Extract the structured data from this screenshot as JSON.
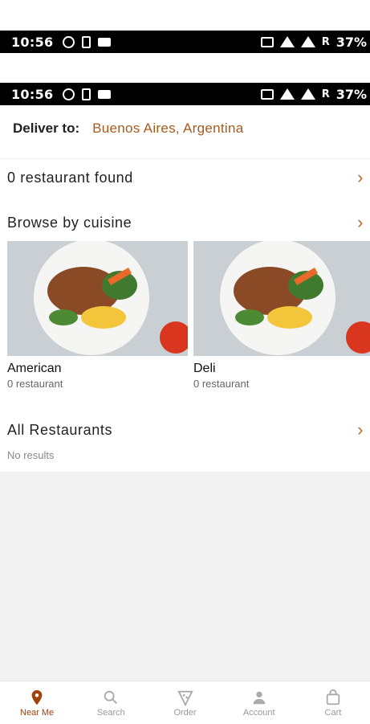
{
  "status_bar": {
    "time": "10:56",
    "battery": "37%",
    "carrier": "R"
  },
  "deliver": {
    "label": "Deliver to:",
    "value": "Buenos Aires, Argentina"
  },
  "restaurants_found": {
    "label": "0 restaurant found"
  },
  "browse": {
    "label": "Browse by cuisine"
  },
  "cuisines": [
    {
      "name": "American",
      "count": "0 restaurant"
    },
    {
      "name": "Deli",
      "count": "0 restaurant"
    }
  ],
  "all_restaurants": {
    "label": "All Restaurants",
    "empty_text": "No results"
  },
  "tabs": [
    {
      "label": "Near Me",
      "icon": "location-pin-icon"
    },
    {
      "label": "Search",
      "icon": "search-icon"
    },
    {
      "label": "Order",
      "icon": "pizza-icon"
    },
    {
      "label": "Account",
      "icon": "user-icon"
    },
    {
      "label": "Cart",
      "icon": "shopping-bag-icon"
    }
  ],
  "colors": {
    "accent": "#a85a1c",
    "active_tab": "#a0420e"
  }
}
